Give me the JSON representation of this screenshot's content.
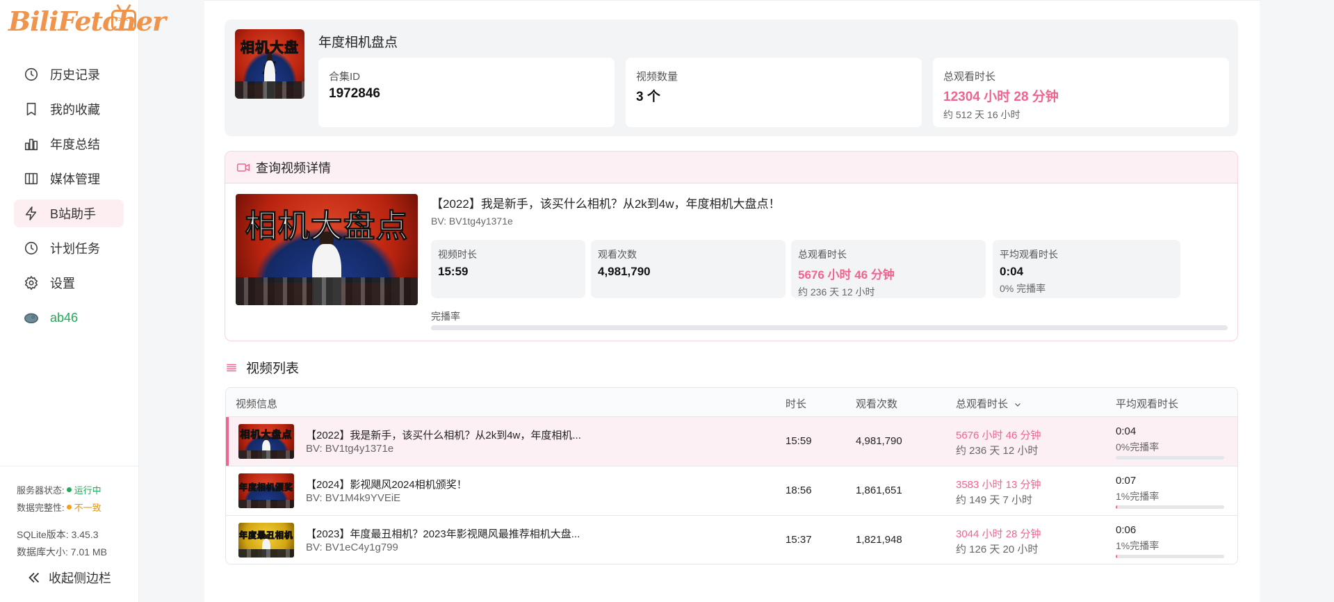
{
  "app": {
    "logo_text": "BiliFetcher"
  },
  "sidebar": {
    "items": [
      {
        "label": "历史记录",
        "icon": "clock-icon"
      },
      {
        "label": "我的收藏",
        "icon": "bookmark-icon"
      },
      {
        "label": "年度总结",
        "icon": "chart-icon"
      },
      {
        "label": "媒体管理",
        "icon": "columns-icon"
      },
      {
        "label": "B站助手",
        "icon": "lightning-icon",
        "active": true
      },
      {
        "label": "计划任务",
        "icon": "clock-icon"
      },
      {
        "label": "设置",
        "icon": "gear-icon"
      },
      {
        "label": "ab46",
        "icon": "avatar-icon"
      }
    ],
    "server_status_label": "服务器状态:",
    "server_status_value": "运行中",
    "data_integrity_label": "数据完整性:",
    "data_integrity_value": "不一致",
    "sqlite_version": "SQLite版本: 3.45.3",
    "db_size": "数据库大小: 7.01 MB",
    "collapse_label": "收起侧边栏"
  },
  "collection": {
    "title": "年度相机盘点",
    "thumb_text": "相机大盘点",
    "cards": [
      {
        "label": "合集ID",
        "value": "1972846"
      },
      {
        "label": "视频数量",
        "value": "3 个"
      },
      {
        "label": "总观看时长",
        "value": "12304 小时 28 分钟",
        "sub": "约 512 天 16 小时"
      }
    ]
  },
  "detail": {
    "header": "查询视频详情",
    "title": "【2022】我是新手，该买什么相机？从2k到4w，年度相机大盘点！",
    "bv": "BV: BV1tg4y1371e",
    "thumb_text": "相机大盘点",
    "cards": [
      {
        "label": "视频时长",
        "value": "15:59"
      },
      {
        "label": "观看次数",
        "value": "4,981,790"
      },
      {
        "label": "总观看时长",
        "value": "5676 小时 46 分钟",
        "sub": "约 236 天 12 小时"
      },
      {
        "label": "平均观看时长",
        "value": "0:04",
        "sub": "0% 完播率"
      }
    ],
    "rate_label": "完播率",
    "rate_fraction": 0.0
  },
  "list": {
    "title": "视频列表",
    "columns": {
      "info": "视频信息",
      "duration": "时长",
      "views": "观看次数",
      "total": "总观看时长",
      "avg": "平均观看时长"
    },
    "rows": [
      {
        "thumb_text": "相机大盘点",
        "title": "【2022】我是新手，该买什么相机？从2k到4w，年度相机...",
        "bv": "BV: BV1tg4y1371e",
        "duration": "15:59",
        "views": "4,981,790",
        "total": "5676 小时 46 分钟",
        "days": "约 236 天 12 小时",
        "avg": "0:04",
        "rate": "0%完播率",
        "rate_fraction": 0.0,
        "active": true
      },
      {
        "thumb_text": "年度相机颁奖",
        "title": "【2024】影视飓风2024相机颁奖！",
        "bv": "BV: BV1M4k9YVEiE",
        "duration": "18:56",
        "views": "1,861,651",
        "total": "3583 小时 13 分钟",
        "days": "约 149 天 7 小时",
        "avg": "0:07",
        "rate": "1%完播率",
        "rate_fraction": 0.01,
        "active": false
      },
      {
        "thumb_text": "年度最丑相机",
        "title": "【2023】年度最丑相机？2023年影视飓风最推荐相机大盘...",
        "bv": "BV: BV1eC4y1g799",
        "duration": "15:37",
        "views": "1,821,948",
        "total": "3044 小时 28 分钟",
        "days": "约 126 天 20 小时",
        "avg": "0:06",
        "rate": "1%完播率",
        "rate_fraction": 0.01,
        "active": false
      }
    ]
  },
  "colors": {
    "accent": "#f0648e",
    "logo": "#f0934b",
    "ok": "#1fab57",
    "warn": "#e6930a"
  }
}
